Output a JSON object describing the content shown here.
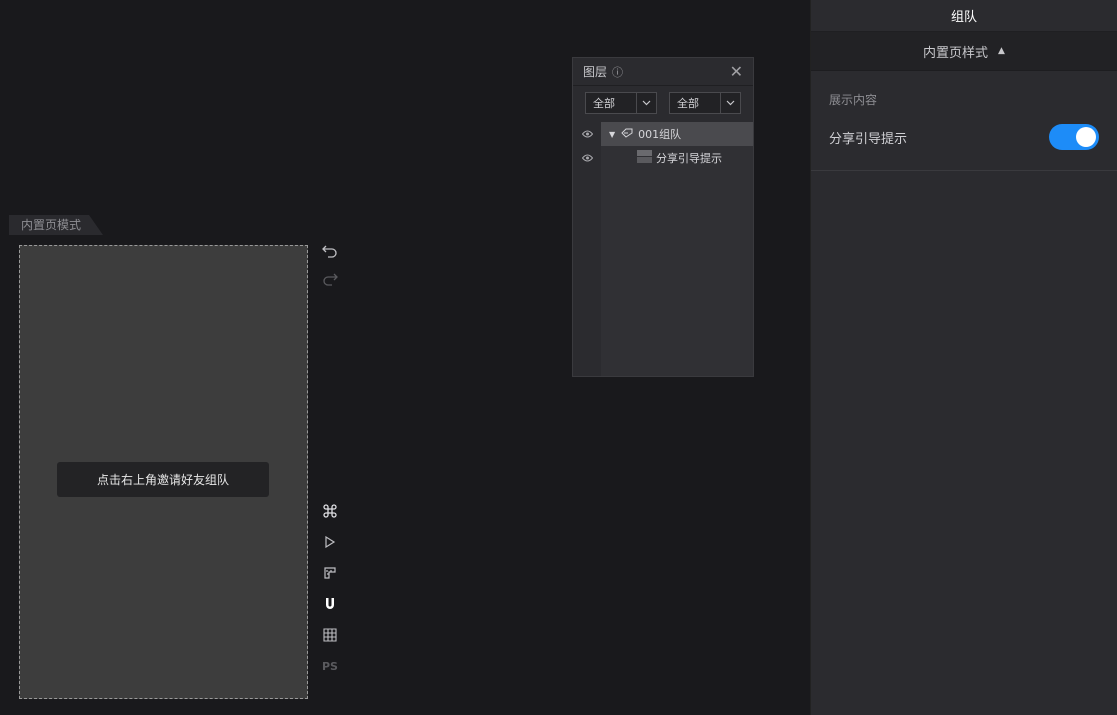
{
  "canvas": {
    "mode_tab": "内置页模式",
    "hint_button": "点击右上角邀请好友组队"
  },
  "layers": {
    "title": "图层",
    "filter1": "全部",
    "filter2": "全部",
    "items": [
      {
        "label": "001组队",
        "selected": true
      },
      {
        "label": "分享引导提示",
        "selected": false
      }
    ]
  },
  "panel": {
    "title": "组队",
    "section": "内置页样式",
    "subheading": "展示内容",
    "toggle_label": "分享引导提示",
    "toggle_on": true,
    "accent": "#1d8cf8"
  },
  "tools": {
    "ps_label": "PS"
  }
}
